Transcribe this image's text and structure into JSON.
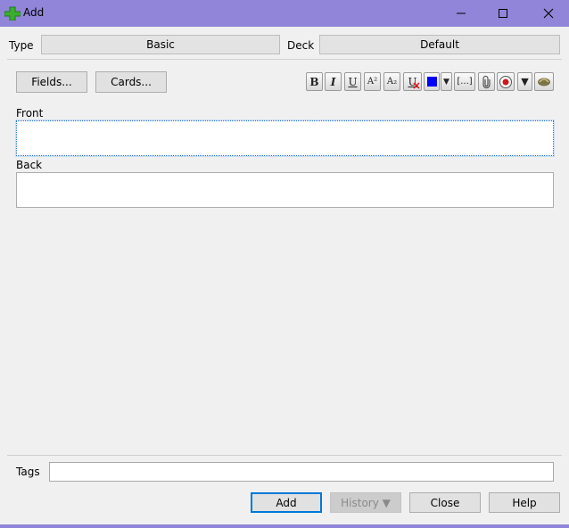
{
  "window": {
    "title": "Add",
    "controls": {
      "minimize": "—",
      "maximize": "☐",
      "close": "✕"
    }
  },
  "type_row": {
    "type_label": "Type",
    "type_value": "Basic",
    "deck_label": "Deck",
    "deck_value": "Default"
  },
  "editor": {
    "fields_button": "Fields...",
    "cards_button": "Cards...",
    "toolbar": {
      "bold": "B",
      "italic": "I",
      "underline": "U",
      "superscript": "A²",
      "subscript": "A₂",
      "clear_format": "U",
      "color": "#0000ff",
      "color_menu": "▼",
      "cloze": "[...]",
      "attach": "attach-icon",
      "record": "record-icon",
      "more_menu": "▼",
      "latex": "latex-icon"
    },
    "fields": [
      {
        "label": "Front",
        "value": ""
      },
      {
        "label": "Back",
        "value": ""
      }
    ]
  },
  "tags": {
    "label": "Tags",
    "value": ""
  },
  "buttons": {
    "add": "Add",
    "history": "History ▼",
    "close": "Close",
    "help": "Help"
  }
}
